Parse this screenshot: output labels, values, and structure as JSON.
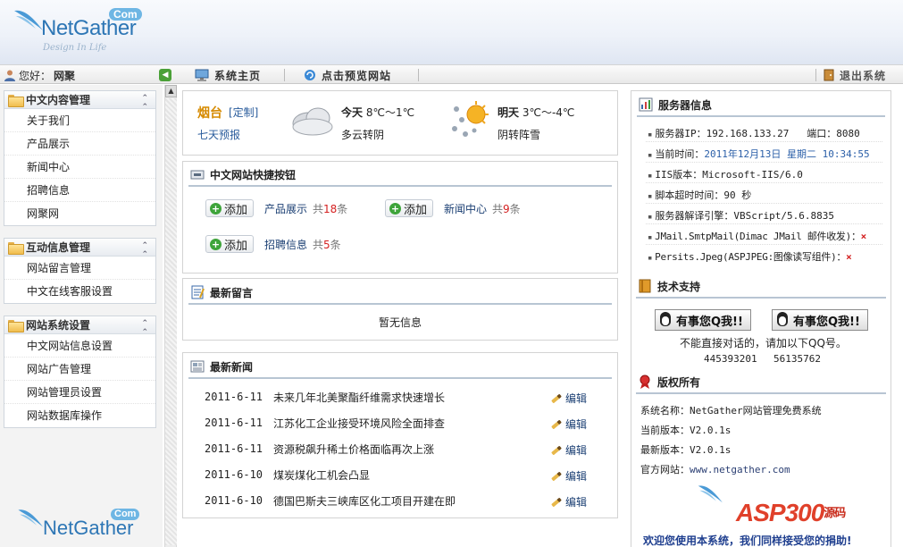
{
  "header": {
    "logo_text": "NetGather",
    "logo_com": "Com",
    "logo_tagline": "Design In Life"
  },
  "nav": {
    "greeting": "您好：",
    "username": "网聚",
    "home_label": "系统主页",
    "preview_label": "点击预览网站",
    "logout_label": "退出系统"
  },
  "sidebar": {
    "groups": [
      {
        "title": "中文内容管理",
        "items": [
          "关于我们",
          "产品展示",
          "新闻中心",
          "招聘信息",
          "网聚网"
        ]
      },
      {
        "title": "互动信息管理",
        "items": [
          "网站留言管理",
          "中文在线客服设置"
        ]
      },
      {
        "title": "网站系统设置",
        "items": [
          "中文网站信息设置",
          "网站广告管理",
          "网站管理员设置",
          "网站数据库操作"
        ]
      }
    ],
    "bottom_logo_text": "NetGather",
    "bottom_logo_com": "Com"
  },
  "weather": {
    "city": "烟台",
    "custom_label": "[定制]",
    "seven_day_label": "七天预报",
    "today": {
      "label": "今天",
      "temp": "8℃～1℃",
      "desc": "多云转阴",
      "icon": "cloudy-icon"
    },
    "tomorrow": {
      "label": "明天",
      "temp": "3℃～-4℃",
      "desc": "阴转阵雪",
      "icon": "snow-sun-icon"
    }
  },
  "quick_buttons": {
    "title": "中文网站快捷按钮",
    "add_label": "添加",
    "items": [
      {
        "name": "产品展示",
        "count_prefix": "共",
        "count": "18",
        "count_suffix": "条"
      },
      {
        "name": "新闻中心",
        "count_prefix": "共",
        "count": "9",
        "count_suffix": "条"
      },
      {
        "name": "招聘信息",
        "count_prefix": "共",
        "count": "5",
        "count_suffix": "条"
      }
    ]
  },
  "messages": {
    "title": "最新留言",
    "empty_text": "暂无信息"
  },
  "news": {
    "title": "最新新闻",
    "edit_label": "编辑",
    "rows": [
      {
        "date": "2011-6-11",
        "title": "未来几年北美聚酯纤维需求快速增长"
      },
      {
        "date": "2011-6-11",
        "title": "江苏化工企业接受环境风险全面排查"
      },
      {
        "date": "2011-6-11",
        "title": "资源税飙升稀土价格面临再次上涨"
      },
      {
        "date": "2011-6-10",
        "title": "煤炭煤化工机会凸显"
      },
      {
        "date": "2011-6-10",
        "title": "德国巴斯夫三峡库区化工项目开建在即"
      }
    ]
  },
  "server": {
    "title": "服务器信息",
    "ip_label": "服务器IP：",
    "ip": "192.168.133.27",
    "port_label": "端口：",
    "port": "8080",
    "time_label": "当前时间：",
    "time": "2011年12月13日 星期二 10:34:55",
    "iis_label": "IIS版本：",
    "iis": "Microsoft-IIS/6.0",
    "timeout_label": "脚本超时时间：",
    "timeout": "90 秒",
    "engine_label": "服务器解译引擎：",
    "engine": "VBScript/5.6.8835",
    "jmail_label": "JMail.SmtpMail(Dimac JMail 邮件收发)：",
    "jmail_status": "×",
    "persits_label": "Persits.Jpeg(ASPJPEG:图像读写组件)：",
    "persits_status": "×"
  },
  "support": {
    "title": "技术支持",
    "qq_button_label": "有事您Q我!!",
    "note": "不能直接对话的，请加以下QQ号。",
    "qq1": "445393201",
    "qq2": "56135762"
  },
  "copyright": {
    "title": "版权所有",
    "system_name_label": "系统名称：",
    "system_name": "NetGather网站管理免费系统",
    "current_version_label": "当前版本：",
    "current_version": "V2.0.1s",
    "latest_version_label": "最新版本：",
    "latest_version": "V2.0.1s",
    "website_label": "官方网站：",
    "website": "www.netgather.com",
    "watermark": "ASP300",
    "watermark_suffix": "源码",
    "footer_message": "欢迎您使用本系统，我们同样接受您的捐助!"
  },
  "colors": {
    "accent_blue": "#2b5fa8",
    "count_red": "#d42020",
    "city_orange": "#d68a00",
    "add_green": "#3ea43a"
  }
}
